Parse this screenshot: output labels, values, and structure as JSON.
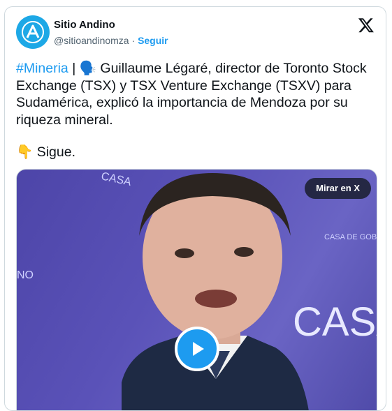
{
  "author": {
    "display_name": "Sitio Andino",
    "handle": "@sitioandinomza",
    "separator": "·",
    "follow_label": "Seguir"
  },
  "tweet": {
    "hashtag": "#Mineria",
    "pipe": " | ",
    "emoji": "🗣️",
    "body": " Guillaume Légaré, director de Toronto Stock Exchange (TSX) y TSX Venture Exchange (TSXV) para Sudamérica, explicó la importancia de Mendoza por su riqueza mineral.",
    "sigue_emoji": "👇",
    "sigue_text": " Sigue."
  },
  "media": {
    "watch_label": "Mirar en X",
    "background_text_1": "CASA",
    "background_text_2": "NO",
    "background_text_3": "CASA DE GOBIERNO"
  },
  "colors": {
    "accent": "#1d9bf0",
    "avatar": "#1da8e6"
  },
  "icons": {
    "x_logo": "x-logo-icon",
    "play": "play-icon",
    "avatar": "sitio-andino-logo"
  }
}
